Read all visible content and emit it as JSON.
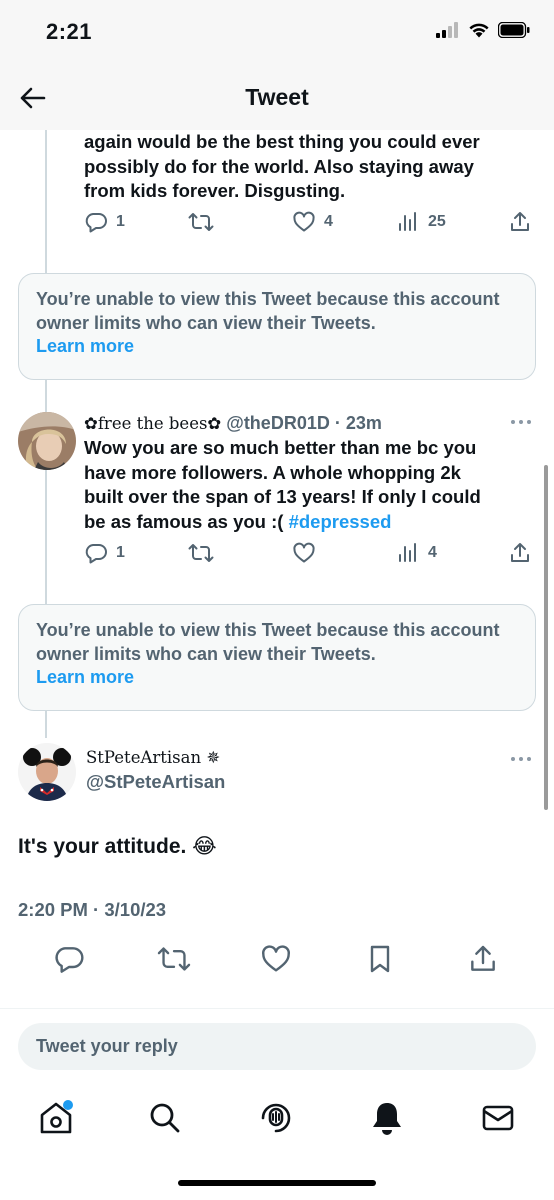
{
  "status_bar": {
    "time": "2:21"
  },
  "header": {
    "title": "Tweet"
  },
  "tweets": [
    {
      "text_lines": [
        "again would be the best thing you could ever",
        "possibly do for the world. Also staying away",
        "from kids forever. Disgusting."
      ],
      "replies": "1",
      "retweets": "",
      "likes": "4",
      "views": "25"
    },
    {
      "display_name": "✿free the bees✿",
      "handle": "@theDR01D",
      "time": "· 23m",
      "text_lines": [
        "Wow you are so much better than me bc you",
        "have more followers. A whole whopping 2k",
        "built over the span of 13 years! If only I could"
      ],
      "text_last": "be as famous as you :( ",
      "hashtag": "#depressed",
      "replies": "1",
      "retweets": "",
      "likes": "",
      "views": "4"
    }
  ],
  "limited_notices": [
    {
      "text": "You’re unable to view this Tweet because this account owner limits who can view their Tweets.",
      "link": "Learn more"
    },
    {
      "text": "You’re unable to view this Tweet because this account owner limits who can view their Tweets.",
      "link": "Learn more"
    }
  ],
  "main_tweet": {
    "display_name": "StPeteArtisan ✵",
    "handle": "@StPeteArtisan",
    "text": "It's your attitude. 😂",
    "timestamp": "2:20 PM · 3/10/23"
  },
  "reply_box": {
    "placeholder": "Tweet your reply"
  },
  "colors": {
    "accent": "#1d9bf0",
    "text": "#0f1419",
    "muted": "#536471",
    "border": "#cfd9de"
  },
  "icons": [
    "back-arrow-icon",
    "reply-icon",
    "retweet-icon",
    "like-icon",
    "views-icon",
    "share-icon",
    "more-icon",
    "bookmark-icon",
    "home-icon",
    "search-icon",
    "spaces-icon",
    "notifications-icon",
    "messages-icon",
    "signal-icon",
    "wifi-icon",
    "battery-icon"
  ]
}
